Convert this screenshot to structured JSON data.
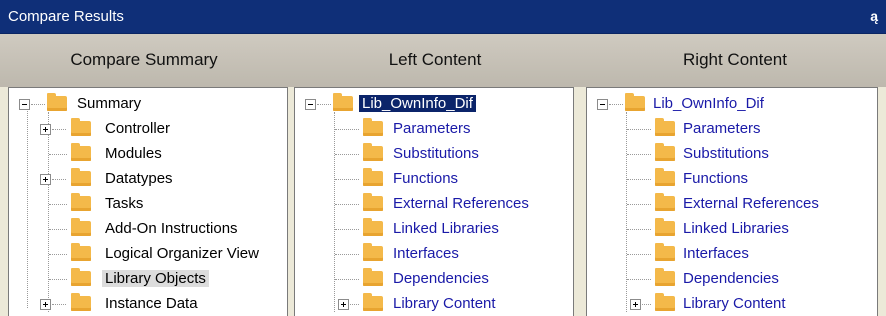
{
  "window": {
    "title": "Compare Results",
    "pin_glyph": "ą"
  },
  "columns": [
    "Compare Summary",
    "Left Content",
    "Right Content"
  ],
  "summary_tree": {
    "root": "Summary",
    "items": [
      "Controller",
      "Modules",
      "Datatypes",
      "Tasks",
      "Add-On Instructions",
      "Logical Organizer View",
      "Library Objects",
      "Instance Data"
    ]
  },
  "left_tree": {
    "root": "Lib_OwnInfo_Dif",
    "items": [
      "Parameters",
      "Substitutions",
      "Functions",
      "External References",
      "Linked Libraries",
      "Interfaces",
      "Dependencies",
      "Library Content"
    ]
  },
  "right_tree": {
    "root": "Lib_OwnInfo_Dif",
    "items": [
      "Parameters",
      "Substitutions",
      "Functions",
      "External References",
      "Linked Libraries",
      "Interfaces",
      "Dependencies",
      "Library Content"
    ]
  }
}
